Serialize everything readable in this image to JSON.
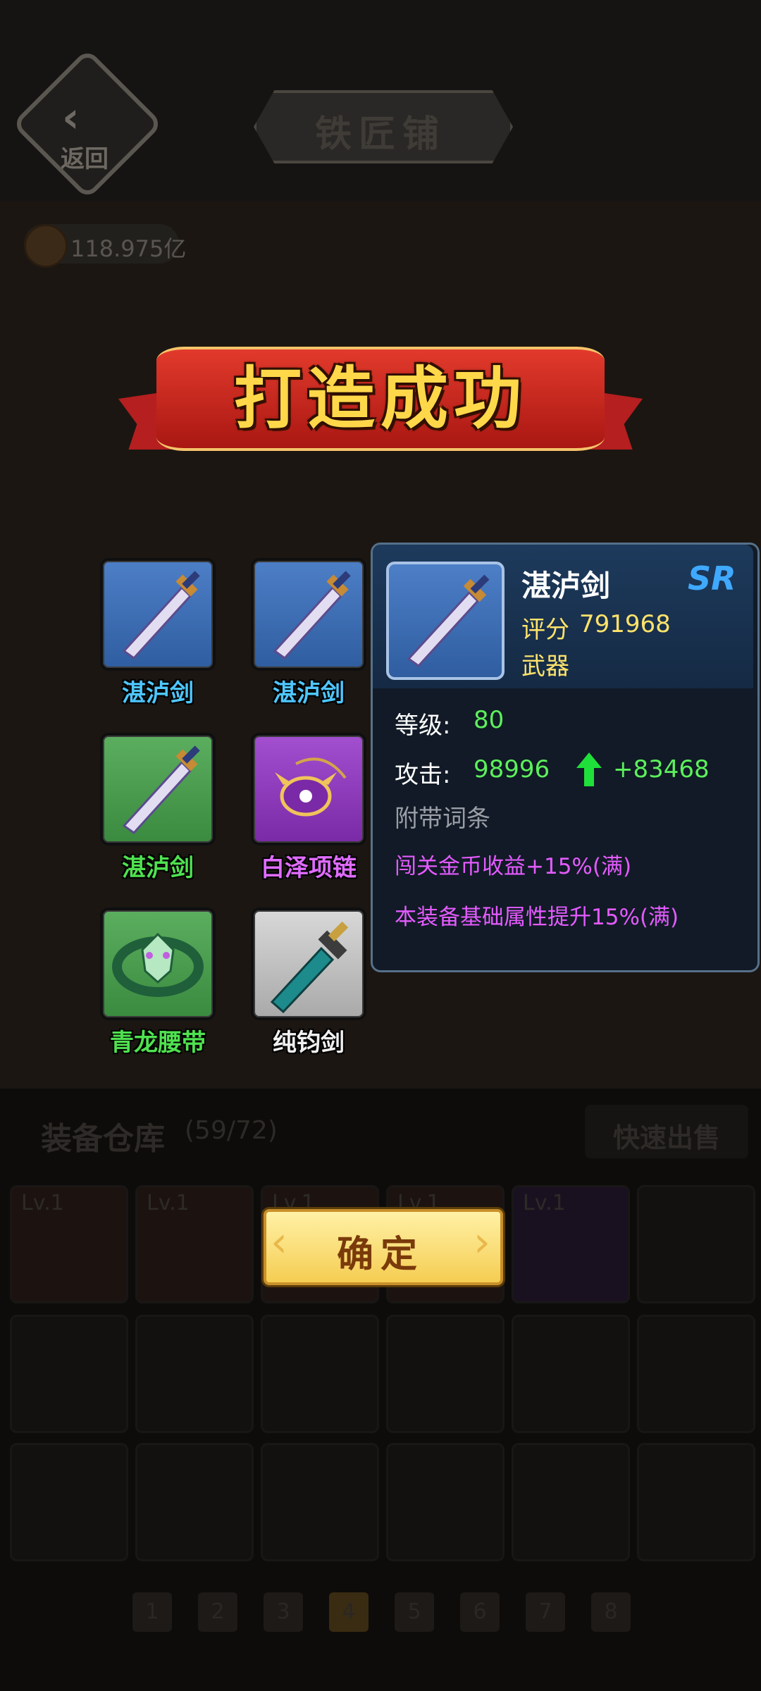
{
  "header": {
    "back_label": "返回",
    "title": "铁匠铺"
  },
  "currency": {
    "amount": "118.975亿",
    "icon": "coin-icon"
  },
  "banner": {
    "text": "打造成功"
  },
  "rewards": [
    {
      "name": "湛泸剑",
      "rarity_color": "blue",
      "icon": "sword-icon"
    },
    {
      "name": "湛泸剑",
      "rarity_color": "blue",
      "icon": "sword-icon"
    },
    {
      "name": "湛泸剑",
      "rarity_color": "green",
      "icon": "sword-icon"
    },
    {
      "name": "白泽项链",
      "rarity_color": "purple",
      "icon": "necklace-icon"
    },
    {
      "name": "青龙腰带",
      "rarity_color": "green",
      "icon": "belt-icon"
    },
    {
      "name": "纯钧剑",
      "rarity_color": "white",
      "icon": "greatsword-icon"
    }
  ],
  "detail": {
    "name": "湛泸剑",
    "rarity": "SR",
    "score_label": "评分",
    "score": "791968",
    "type": "武器",
    "level_label": "等级:",
    "level": "80",
    "attack_label": "攻击:",
    "attack": "98996",
    "attack_delta": "+83468",
    "affix_title": "附带词条",
    "affixes": [
      "闯关金币收益+15%(满)",
      "本装备基础属性提升15%(满)"
    ]
  },
  "inventory": {
    "title": "装备仓库",
    "count": "(59/72)",
    "quick_sell": "快速出售",
    "slot_levels": [
      "Lv.1",
      "Lv.1",
      "Lv.1",
      "Lv.1",
      "Lv.1"
    ],
    "pages": [
      "1",
      "2",
      "3",
      "4",
      "5",
      "6",
      "7",
      "8"
    ],
    "current_page": "4"
  },
  "confirm_label": "确定"
}
